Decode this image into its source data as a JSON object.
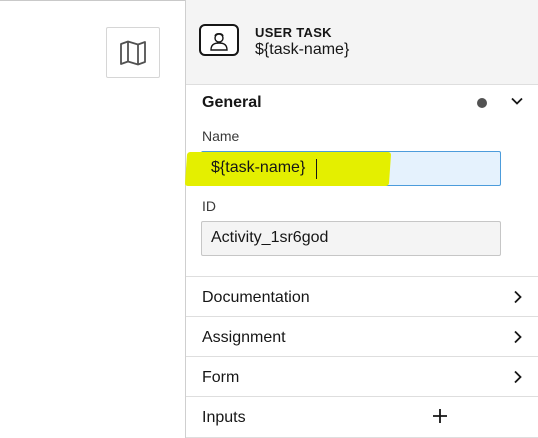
{
  "header": {
    "element_type": "USER TASK",
    "element_name": "${task-name}",
    "icon": "user-task-icon"
  },
  "canvas": {
    "map_toggle_icon": "map-icon"
  },
  "general": {
    "title": "General",
    "changed_indicator": "dot",
    "name_label": "Name",
    "name_value": "${task-name}",
    "id_label": "ID",
    "id_value": "Activity_1sr6god"
  },
  "groups": [
    {
      "label": "Documentation",
      "action": "chevron-right-icon"
    },
    {
      "label": "Assignment",
      "action": "chevron-right-icon"
    },
    {
      "label": "Form",
      "action": "chevron-right-icon"
    },
    {
      "label": "Inputs",
      "action": "plus-icon"
    }
  ],
  "colors": {
    "highlight": "#e4ef00",
    "input_focus_bg": "#e5f2fd",
    "input_focus_border": "#4c9cdb"
  }
}
